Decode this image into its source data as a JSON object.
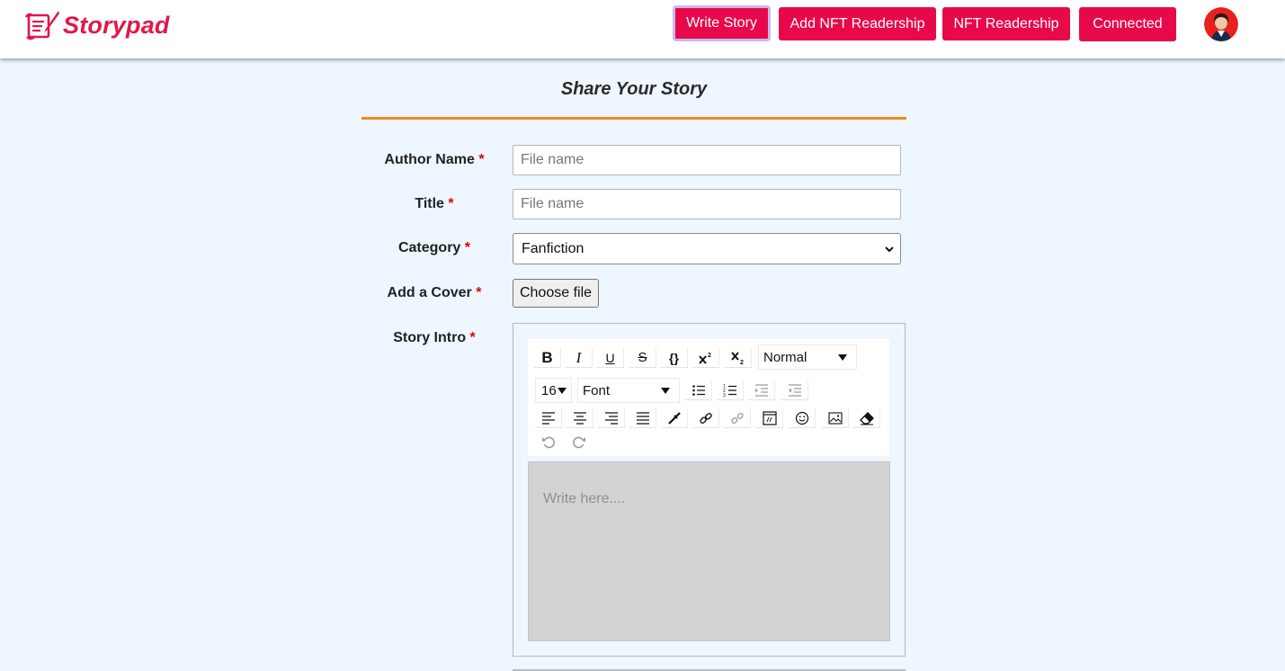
{
  "brand": {
    "name": "Storypad",
    "color": "#e0184a"
  },
  "nav": {
    "write_story": "Write Story",
    "add_nft_readership": "Add NFT Readership",
    "nft_readership": "NFT Readership",
    "connected": "Connected"
  },
  "form": {
    "title": "Share Your Story",
    "required_mark": "*",
    "author_label": "Author Name",
    "author_placeholder": "File name",
    "title_label": "Title",
    "title_placeholder": "File name",
    "category_label": "Category",
    "category_value": "Fanfiction",
    "cover_label": "Add a Cover",
    "cover_button": "Choose file",
    "intro_label": "Story Intro"
  },
  "editor": {
    "header_select": "Normal",
    "font_size": "16",
    "font_select": "Font",
    "placeholder": "Write here....",
    "icons": [
      "bold-icon",
      "italic-icon",
      "underline-icon",
      "strikethrough-icon",
      "code-icon",
      "superscript-icon",
      "subscript-icon",
      "bullet-list-icon",
      "ordered-list-icon",
      "indent-icon",
      "outdent-icon",
      "align-left-icon",
      "align-center-icon",
      "align-right-icon",
      "align-justify-icon",
      "color-picker-icon",
      "link-icon",
      "unlink-icon",
      "embed-icon",
      "emoji-icon",
      "image-icon",
      "eraser-icon",
      "undo-icon",
      "redo-icon"
    ]
  },
  "colors": {
    "accent": "#e8094a",
    "page_bg": "#eef6ff",
    "rule": "#ee8c1f",
    "required": "#e00000"
  }
}
